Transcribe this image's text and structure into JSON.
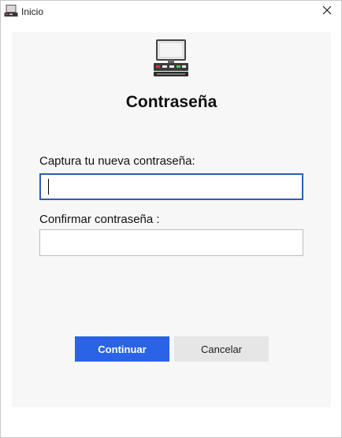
{
  "window": {
    "title": "Inicio",
    "title_icon": "monitor-icon",
    "close_icon": "close-icon"
  },
  "panel": {
    "icon": "computer-terminal-icon",
    "heading": "Contraseña",
    "new_password": {
      "label": "Captura tu nueva contraseña:",
      "value": ""
    },
    "confirm_password": {
      "label": "Confirmar contraseña :",
      "value": ""
    },
    "continue_label": "Continuar",
    "cancel_label": "Cancelar"
  },
  "colors": {
    "accent": "#2a63e6",
    "focus_border": "#2f5db3",
    "panel_bg": "#f7f7f7",
    "cancel_bg": "#e6e6e6"
  }
}
